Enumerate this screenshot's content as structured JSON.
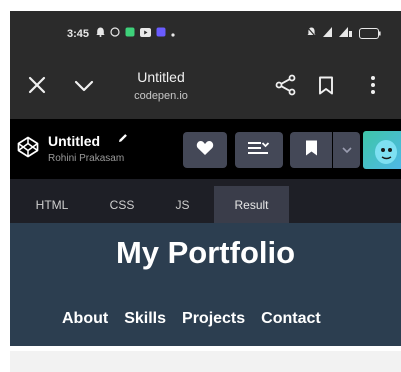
{
  "status_bar": {
    "time": "3:45",
    "icons": [
      "alarm-icon",
      "whatsapp-icon",
      "app-icon",
      "youtube-icon",
      "app-icon",
      "dot-icon"
    ],
    "right_icons": [
      "silent-icon",
      "signal-icon",
      "signal-icon",
      "battery-icon"
    ],
    "battery": "38"
  },
  "browser_bar": {
    "title": "Untitled",
    "url": "codepen.io",
    "colors": {
      "background": "#2b2b2b"
    }
  },
  "codepen_header": {
    "title": "Untitled",
    "author": "Rohini Prakasam",
    "colors": {
      "background": "#000000",
      "button": "#444857",
      "avatar": "#3ec6a8"
    }
  },
  "tabs": [
    {
      "label": "HTML",
      "active": false
    },
    {
      "label": "CSS",
      "active": false
    },
    {
      "label": "JS",
      "active": false
    },
    {
      "label": "Result",
      "active": true
    }
  ],
  "preview": {
    "heading": "My Portfolio",
    "nav": [
      "About",
      "Skills",
      "Projects",
      "Contact"
    ],
    "colors": {
      "background": "#2c3e50",
      "text": "#ffffff"
    }
  }
}
